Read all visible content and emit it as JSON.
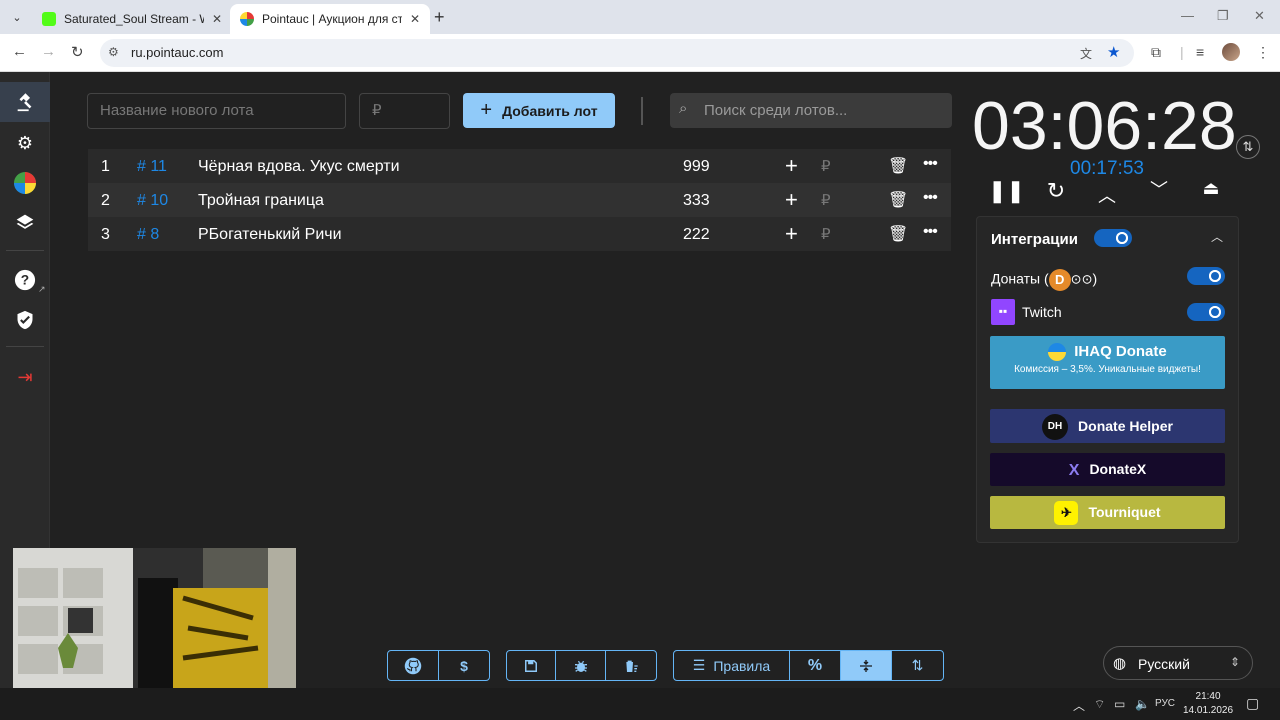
{
  "browser": {
    "tabs": [
      {
        "title": "Saturated_Soul Stream - Watch",
        "close": "✕",
        "favicon_color": "#53fc18"
      },
      {
        "title": "Pointauc | Аукцион для стриме",
        "close": "✕",
        "favicon_color": "#9c27b0"
      }
    ],
    "url": "ru.pointauc.com"
  },
  "form": {
    "lot_name_placeholder": "Название нового лота",
    "amount_placeholder": "₽",
    "add_button": "Добавить лот",
    "search_placeholder": "Поиск среди лотов..."
  },
  "lots": [
    {
      "index": "1",
      "fast_id": "# 11",
      "name": "Чёрная вдова. Укус смерти",
      "amount": "999"
    },
    {
      "index": "2",
      "fast_id": "# 10",
      "name": "Тройная граница",
      "amount": "333"
    },
    {
      "index": "3",
      "fast_id": "# 8",
      "name": "РБогатенький Ричи",
      "amount": "222"
    }
  ],
  "timer": {
    "main": "03:06:28",
    "secondary": "00:17:53"
  },
  "integrations": {
    "title": "Интеграции",
    "donations_label": "Донаты (",
    "donations_suffix": ")",
    "twitch_label": "Twitch",
    "services": [
      {
        "name": "IHAQ Donate",
        "subtitle": "Комиссия – 3,5%. Уникальные виджеты!",
        "color": "#3a9bc6"
      },
      {
        "name": "Donate Helper",
        "logo_text": "DH",
        "color": "#2c3670"
      },
      {
        "name": "DonateX",
        "logo_text": "X",
        "color": "#150a2a"
      },
      {
        "name": "Tourniquet",
        "color": "#b8b840"
      }
    ]
  },
  "bottom_bar": {
    "rules_label": "Правила",
    "percent_label": "%",
    "dollar_label": "$"
  },
  "language": "Русский",
  "taskbar": {
    "lang": "РУС",
    "time": "21:40",
    "date": "14.01.2026"
  },
  "colors": {
    "accent": "#90caf9",
    "link_blue": "#1e88e5",
    "background": "#212121"
  }
}
